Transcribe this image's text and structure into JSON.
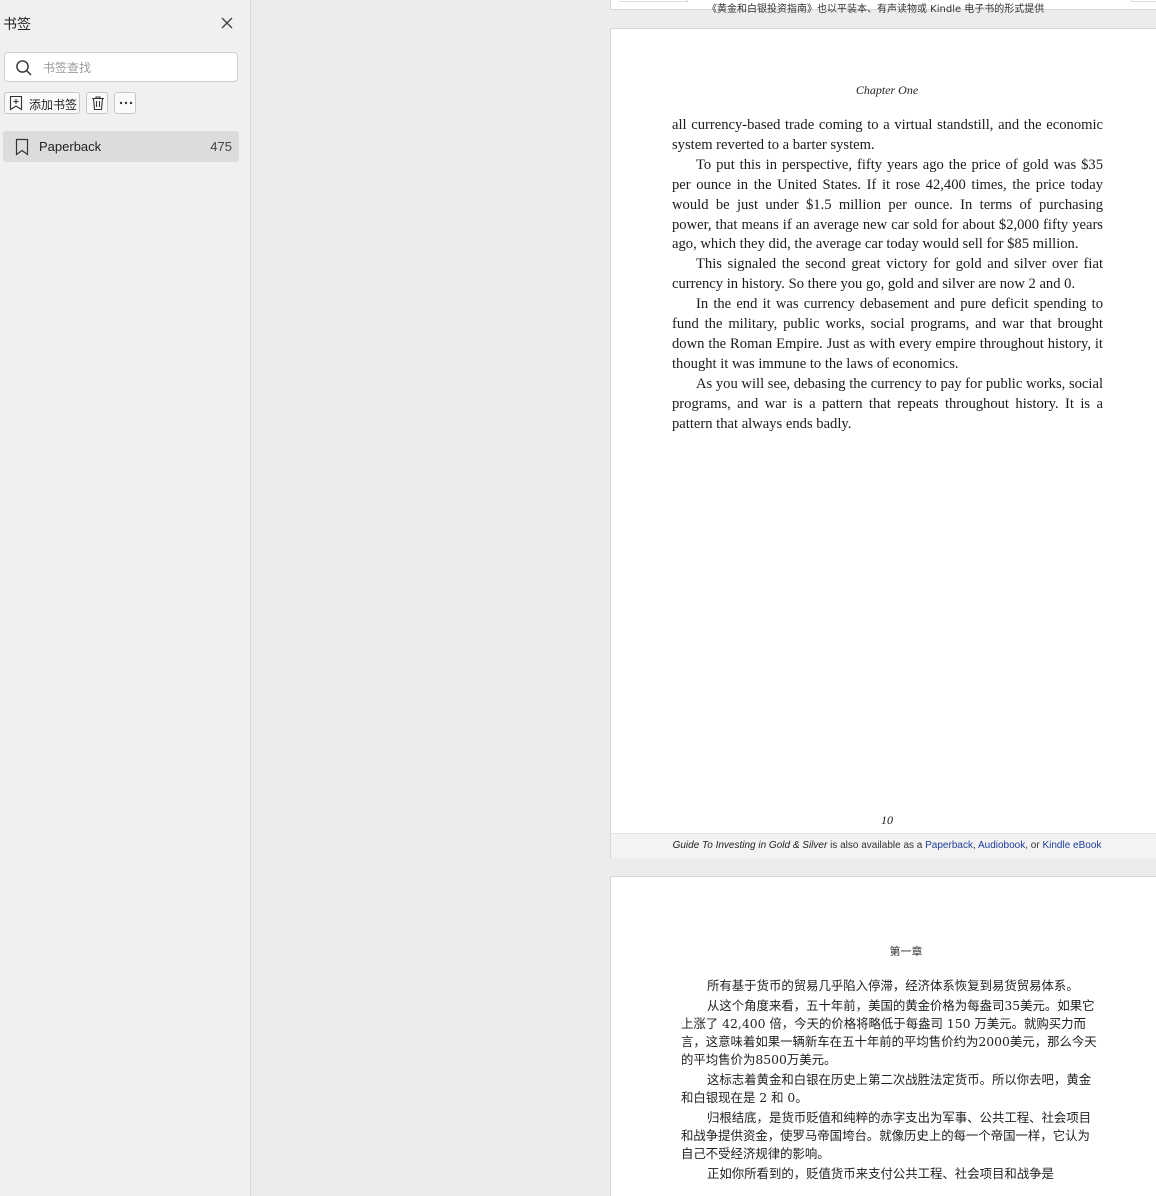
{
  "sidebar": {
    "title": "书签",
    "search_placeholder": "书签查找",
    "add_bookmark_label": "添加书签",
    "bookmarks": [
      {
        "name": "Paperback",
        "page": "475"
      }
    ]
  },
  "viewer": {
    "prev_page_fragment": "《黄金和白银投资指南》也以平装本、有声读物或 Kindle 电子书的形式提供",
    "english_page": {
      "chapter_header": "Chapter One",
      "paragraphs": [
        "all currency-based trade coming to a virtual standstill, and the economic system reverted to a barter system.",
        "To put this in perspective, fifty years ago the price of gold was $35 per ounce in the United States. If it rose 42,400 times, the price today would be just under $1.5 million per ounce. In terms of purchasing power, that means if an average new car sold for about $2,000 fifty years ago, which they did, the average car today would sell for $85 million.",
        "This signaled the second great victory for gold and silver over fiat currency in history. So there you go, gold and silver are now 2 and 0.",
        "In the end it was currency debasement and pure deficit spending to fund the military, public works, social programs, and war that brought down the Roman Empire. Just as with every empire throughout history, it thought it was immune to the laws of economics.",
        "As you will see, debasing the currency to pay for public works, social programs, and war is a pattern that repeats throughout history. It is a pattern that always ends badly."
      ],
      "page_number": "10",
      "footer": {
        "book_title": "Guide To Investing in Gold & Silver",
        "middle_text": " is also available as a ",
        "link_paperback": "Paperback",
        "sep1": ", ",
        "link_audiobook": "Audiobook",
        "sep2": ", or ",
        "link_kindle": "Kindle eBook"
      }
    },
    "chinese_page": {
      "chapter_header": "第一章",
      "paragraphs": [
        "所有基于货币的贸易几乎陷入停滞，经济体系恢复到易货贸易体系。",
        "从这个角度来看，五十年前，美国的黄金价格为每盎司35美元。如果它上涨了 42,400 倍，今天的价格将略低于每盎司 150 万美元。就购买力而言，这意味着如果一辆新车在五十年前的平均售价约为2000美元，那么今天的平均售价为8500万美元。",
        "这标志着黄金和白银在历史上第二次战胜法定货币。所以你去吧，黄金和白银现在是 2 和 0。",
        "归根结底，是货币贬值和纯粹的赤字支出为军事、公共工程、社会项目和战争提供资金，使罗马帝国垮台。就像历史上的每一个帝国一样，它认为自己不受经济规律的影响。",
        "正如你所看到的，贬值货币来支付公共工程、社会项目和战争是"
      ]
    }
  },
  "colors": {
    "sidebar_bg": "#f0f0f0",
    "selected_item_bg": "#dcdcdc",
    "link": "#1f3d9a"
  }
}
